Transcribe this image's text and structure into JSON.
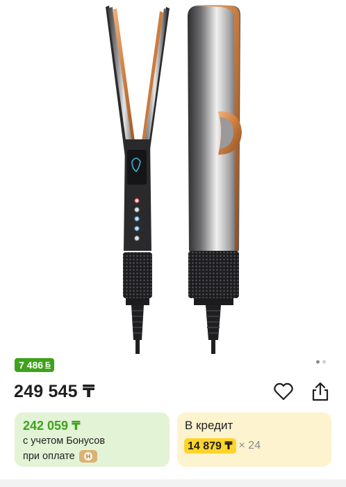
{
  "product": {
    "image_alt": "Dyson Airstrait straightener",
    "gallery_dots": 2,
    "gallery_active": 1
  },
  "bonus_badge": {
    "amount": "7 486",
    "currency_symbol": "Б"
  },
  "price": "249 545 ₸",
  "actions": {
    "favorite_icon": "heart-icon",
    "share_icon": "share-icon"
  },
  "bonus_card": {
    "price": "242 059 ₸",
    "line1": "с учетом Бонусов",
    "line2": "при оплате"
  },
  "credit_card": {
    "title": "В кредит",
    "monthly": "14 879 ₸",
    "months": "× 24"
  },
  "colors": {
    "green": "#3fa21c",
    "green_bg": "#e3f3d6",
    "yellow": "#fed42b",
    "yellow_bg": "#fdf3cf",
    "copper": "#d08a4e"
  }
}
